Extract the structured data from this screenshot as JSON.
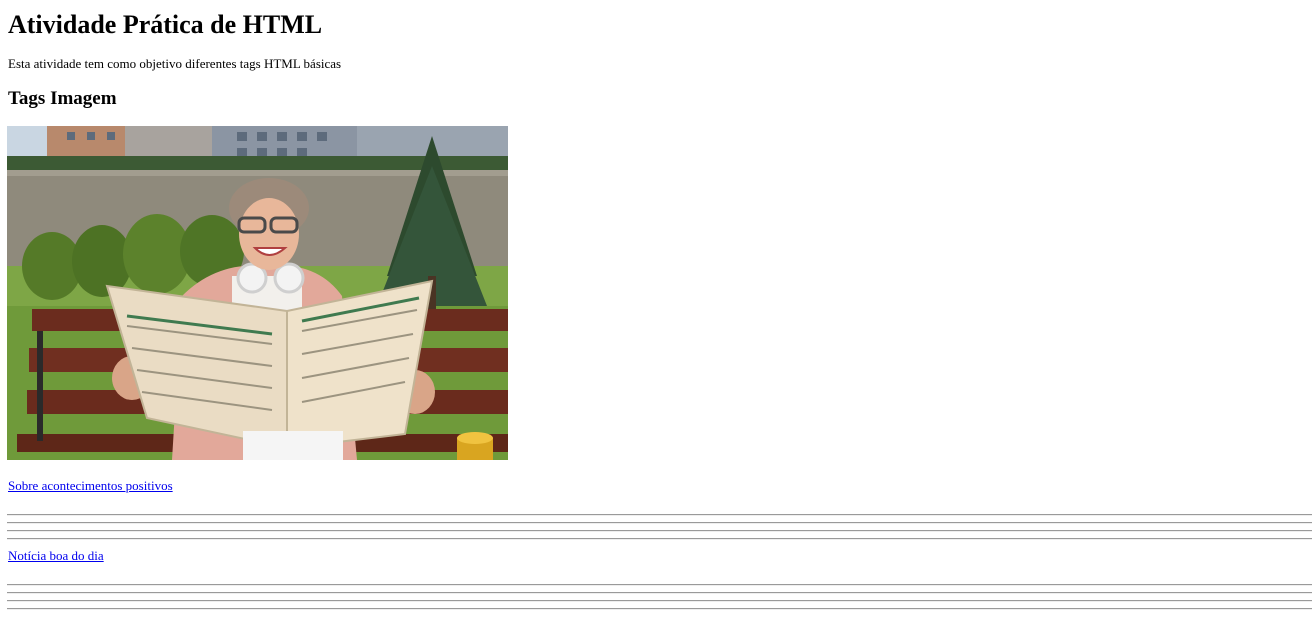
{
  "page": {
    "title": "Atividade Prática de HTML",
    "intro": "Esta atividade tem como objetivo diferentes tags HTML básicas",
    "section_heading": "Tags Imagem",
    "image": {
      "subject": "older woman smiling on a park bench reading a newspaper"
    },
    "links": [
      {
        "label": "Sobre acontecimentos positivos"
      },
      {
        "label": "Notícia boa do dia"
      }
    ]
  },
  "colors": {
    "link": "#0000ee",
    "rule": "#9a9a9a"
  }
}
